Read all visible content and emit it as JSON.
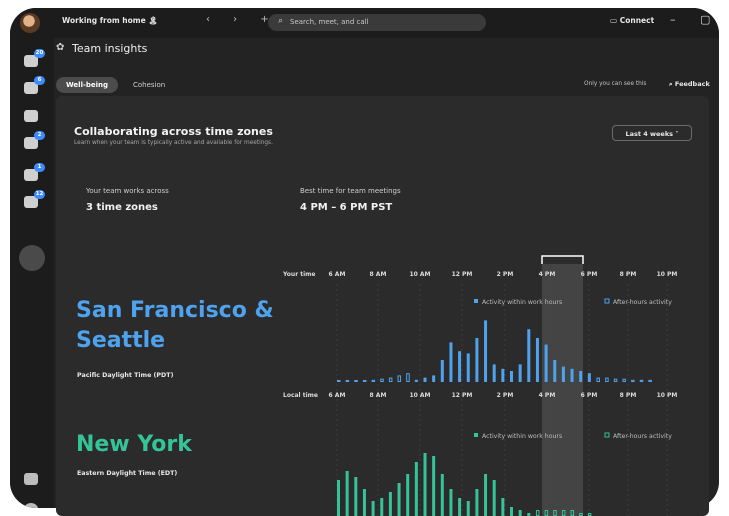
{
  "window": {
    "status_text": "Working from home 🏝",
    "nav_arrows": "‹ › +",
    "search_placeholder": "Search, meet, and call",
    "connect_label": "Connect"
  },
  "sidebar": {
    "badges": [
      "20",
      "6",
      "2",
      "1",
      "12"
    ]
  },
  "header": {
    "title": "Team insights",
    "tabs": [
      {
        "label": "Well-being",
        "active": true
      },
      {
        "label": "Cohesion",
        "active": false
      }
    ],
    "privacy_note": "Only you can see this",
    "feedback_label": "Feedback"
  },
  "card": {
    "title": "Collaborating across time zones",
    "subtitle": "Learn when your team is typically active and available for meetings.",
    "range_label": "Last 4 weeks",
    "works_across_label": "Your team works across",
    "works_across_value": "3 time zones",
    "best_time_label": "Best time for team meetings",
    "best_time_value": "4 PM – 6 PM PST"
  },
  "timeline": {
    "your_time_label": "Your time",
    "local_time_label": "Local time",
    "top_ticks": [
      "6 AM",
      "8 AM",
      "10 AM",
      "12 PM",
      "2 PM",
      "4 PM",
      "6 PM",
      "8 PM",
      "10 PM"
    ],
    "local_ticks": [
      "6 AM",
      "8 AM",
      "10 AM",
      "12 PM",
      "2 PM",
      "4 PM",
      "6 PM",
      "8 PM",
      "10 PM"
    ]
  },
  "locations": [
    {
      "city": "San Francisco & Seattle",
      "timezone": "Pacific Daylight Time (PDT)",
      "color": "#4fa3ee",
      "legend_work": "Activity within work hours",
      "legend_after": "After-hours activity"
    },
    {
      "city": "New York",
      "timezone": "Eastern Daylight Time (EDT)",
      "color": "#35c398",
      "legend_work": "Activity within work hours",
      "legend_after": "After-hours activity"
    }
  ],
  "chart_data": [
    {
      "type": "bar",
      "title": "San Francisco & Seattle",
      "series": [
        {
          "name": "Activity within work hours",
          "values": [
            0,
            0,
            0,
            0,
            0,
            0,
            0,
            0,
            0,
            1,
            2,
            3,
            10,
            18,
            14,
            13,
            20,
            28,
            8,
            6,
            5,
            8,
            24,
            20,
            17,
            10,
            7,
            6,
            5,
            4,
            0,
            0,
            0,
            0,
            0,
            0,
            0
          ]
        },
        {
          "name": "After-hours activity",
          "values": [
            0.5,
            0.5,
            0.5,
            0.5,
            1,
            1.5,
            2,
            3,
            4,
            0,
            0,
            0,
            0,
            0,
            0,
            0,
            0,
            0,
            0,
            0,
            0,
            0,
            0,
            0,
            0,
            0,
            0,
            0,
            0,
            0,
            2,
            2,
            1.5,
            1.5,
            1,
            1,
            1
          ]
        }
      ]
    },
    {
      "type": "bar",
      "title": "New York",
      "series": [
        {
          "name": "Activity within work hours",
          "values": [
            12,
            15,
            13,
            9,
            5,
            6,
            8,
            11,
            14,
            18,
            21,
            20,
            14,
            9,
            6,
            5,
            9,
            14,
            12,
            6,
            3,
            2,
            1,
            0,
            0,
            0,
            0,
            0,
            0,
            0,
            0,
            0,
            0
          ]
        },
        {
          "name": "After-hours activity",
          "values": [
            0,
            0,
            0,
            0,
            0,
            0,
            0,
            0,
            0,
            0,
            0,
            0,
            0,
            0,
            0,
            0,
            0,
            0,
            0,
            0,
            0,
            0,
            0,
            2,
            2,
            2,
            2,
            2,
            1,
            1,
            0,
            0,
            0
          ]
        }
      ]
    }
  ]
}
